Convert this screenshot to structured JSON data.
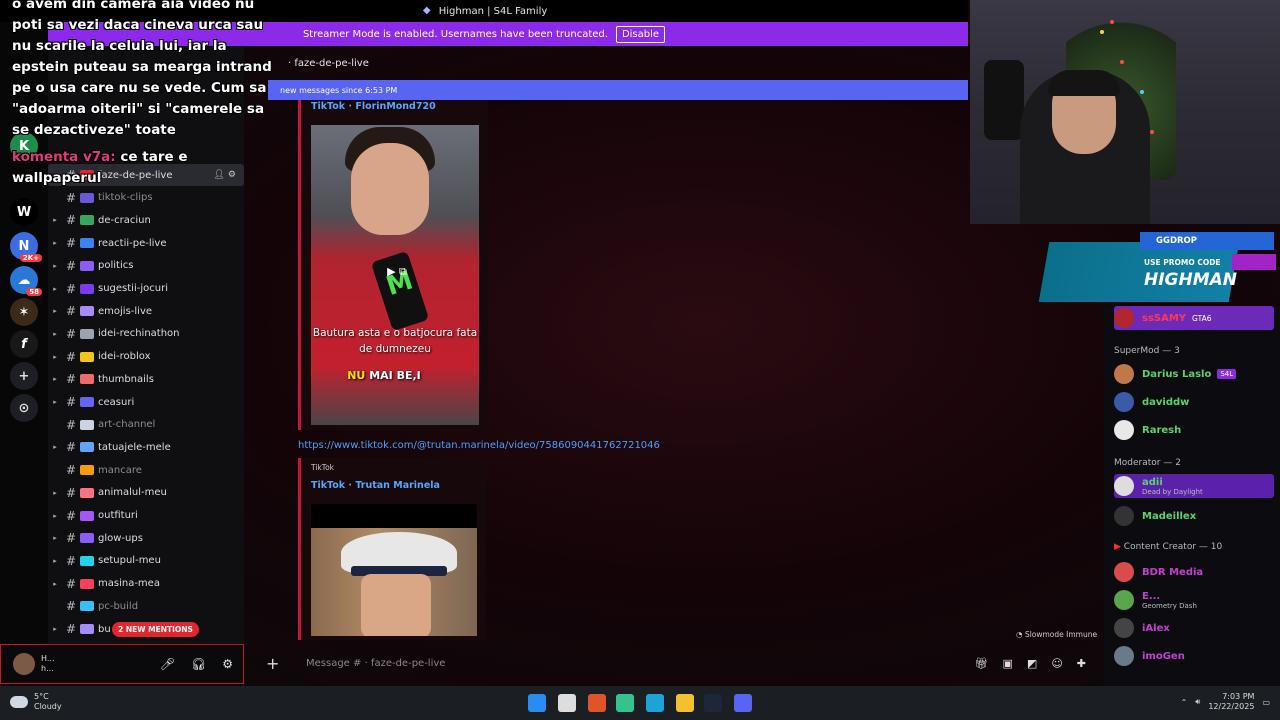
{
  "window": {
    "title": "Highman | S4L Family"
  },
  "streamer_banner": {
    "text": "Streamer Mode is enabled. Usernames have been truncated.",
    "button": "Disable"
  },
  "overlay_chat": {
    "lines": [
      "o avem din camera aia video nu",
      "poti sa vezi daca cineva urca sau",
      "nu scarile la celula lui, iar la",
      "epstein puteau sa mearga intrand",
      "pe o usa care nu se vede. Cum sa",
      "\"adoarma oiterii\" si \"camerele sa",
      "se dezactiveze\" toate"
    ],
    "nick": "komenta v7a:",
    "nick_msg": "ce tare e",
    "nick_msg2": "wallpaperul"
  },
  "channels": [
    {
      "name": "faze-de-pe-live",
      "active": true,
      "color": "#e0262e"
    },
    {
      "name": "tiktok-clips",
      "muted": true,
      "color": "#6a59d6"
    },
    {
      "name": "de-craciun",
      "color": "#3aa55d"
    },
    {
      "name": "reactii-pe-live",
      "color": "#3b82f6"
    },
    {
      "name": "politics",
      "color": "#8b5cf6"
    },
    {
      "name": "sugestii-jocuri",
      "color": "#7c3aed"
    },
    {
      "name": "emojis-live",
      "color": "#a78bfa"
    },
    {
      "name": "idei-rechinathon",
      "color": "#9ca3af"
    },
    {
      "name": "idei-roblox",
      "color": "#f5c518"
    },
    {
      "name": "thumbnails",
      "color": "#ef6b6b"
    },
    {
      "name": "ceasuri",
      "color": "#6366f1"
    },
    {
      "name": "art-channel",
      "muted": true,
      "color": "#cbd5e1"
    },
    {
      "name": "tatuajele-mele",
      "color": "#60a5fa"
    },
    {
      "name": "mancare",
      "muted": true,
      "color": "#f59e0b"
    },
    {
      "name": "animalul-meu",
      "color": "#fb7185"
    },
    {
      "name": "outfituri",
      "color": "#a855f7"
    },
    {
      "name": "glow-ups",
      "color": "#8b5cf6"
    },
    {
      "name": "setupul-meu",
      "color": "#22d3ee"
    },
    {
      "name": "masina-mea",
      "color": "#f43f5e"
    },
    {
      "name": "pc-build",
      "muted": true,
      "color": "#38bdf8"
    },
    {
      "name": "bu",
      "color": "#a78bfa"
    }
  ],
  "mentions_pill": "2 NEW MENTIONS",
  "user_panel": {
    "name": "H...",
    "sub": "h..."
  },
  "chat": {
    "channel": "faze-de-pe-live",
    "new_messages": "new messages since 6:53 PM",
    "embed1": {
      "title": "TikTok · FlorinMond720",
      "caption": "Bautura asta e o batjocura fata de dumnezeu",
      "caption2_a": "NU",
      "caption2_b": "MAI BE,I"
    },
    "link": "https://www.tiktok.com/@trutan.marinela/video/7586090441762721046",
    "embed2": {
      "provider": "TikTok",
      "title": "TikTok · Trutan Marinela"
    },
    "slowmode": "Slowmode Immune",
    "composer_placeholder": "Message # · faze-de-pe-live"
  },
  "members": {
    "groups": [
      {
        "label": "SuperMod — 3"
      },
      {
        "label": "Moderator — 2"
      },
      {
        "label": "Content Creator — 10"
      }
    ],
    "top_name": "ssSAMY",
    "top_tag": "GTA6",
    "supermods": [
      {
        "name": "Darius Laslo",
        "tag": "S4L",
        "color": "#5ad36a"
      },
      {
        "name": "daviddw",
        "color": "#5ad36a"
      },
      {
        "name": "Raresh",
        "color": "#5ad36a"
      }
    ],
    "moderators": [
      {
        "name": "adii",
        "sub": "Dead by Daylight",
        "color": "#5ad36a"
      },
      {
        "name": "Madeillex",
        "color": "#5ad36a"
      }
    ],
    "creators": [
      {
        "name": "BDR Media",
        "color": "#c43fd1"
      },
      {
        "name": "E...",
        "sub": "Geometry Dash",
        "color": "#c43fd1"
      },
      {
        "name": "iAlex",
        "color": "#c43fd1"
      },
      {
        "name": "imoGen",
        "color": "#c43fd1"
      }
    ]
  },
  "promo": {
    "tag": "GGDROP",
    "line1": "USE PROMO CODE",
    "line2": "HIGHMAN"
  },
  "taskbar": {
    "weather_temp": "5°C",
    "weather_desc": "Cloudy",
    "time": "7:03 PM",
    "date": "12/22/2025"
  }
}
